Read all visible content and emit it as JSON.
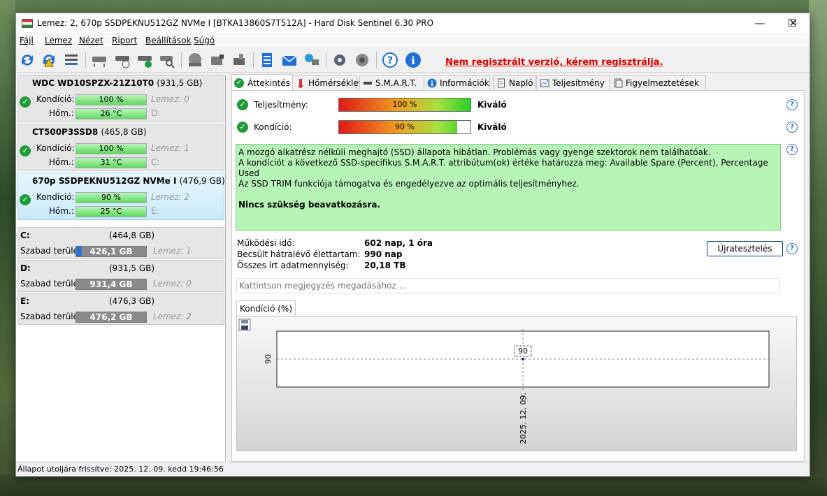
{
  "window": {
    "title": "Lemez: 2, 670p SSDPEKNU512GZ NVMe I [BTKA13860S7T512A]  -  Hard Disk Sentinel 6.30 PRO",
    "controls": {
      "minimize": "—",
      "maximize": "☐",
      "close": "✕"
    }
  },
  "menu": [
    "Fájl",
    "Lemez",
    "Nézet",
    "Riport",
    "Beállítások",
    "Súgó"
  ],
  "toolbar": {
    "unregistered": "Nem regisztrált verzió, kérem regisztrálja."
  },
  "disks": [
    {
      "name": "WDC WD10SPZX-21Z10T0",
      "size": "(931,5 GB)",
      "health_label": "Kondíció:",
      "health": "100 %",
      "health_pct": 100,
      "temp_label": "Hőm.:",
      "temp": "26 °C",
      "disk_label": "Lemez: 0",
      "drive": "D:"
    },
    {
      "name": "CT500P3SSD8",
      "size": "(465,8 GB)",
      "health_label": "Kondíció:",
      "health": "100 %",
      "health_pct": 100,
      "temp_label": "Hőm.:",
      "temp": "31 °C",
      "disk_label": "Lemez: 1",
      "drive": "C:"
    },
    {
      "name": "670p SSDPEKNU512GZ NVMe I",
      "size": "(476,9 GB)",
      "health_label": "Kondíció:",
      "health": "90 %",
      "health_pct": 90,
      "temp_label": "Hőm.:",
      "temp": "25 °C",
      "disk_label": "Lemez: 2",
      "drive": "E:"
    }
  ],
  "volumes": [
    {
      "letter": "C:",
      "size": "(464,8 GB)",
      "free_label": "Szabad terület",
      "free": "426,1 GB",
      "used_fraction": 0.08,
      "disk_label": "Lemez: 1"
    },
    {
      "letter": "D:",
      "size": "(931,5 GB)",
      "free_label": "Szabad terület",
      "free": "931,4 GB",
      "used_fraction": 0.0,
      "disk_label": "Lemez: 0"
    },
    {
      "letter": "E:",
      "size": "(476,3 GB)",
      "free_label": "Szabad terület",
      "free": "476,2 GB",
      "used_fraction": 0.0,
      "disk_label": "Lemez: 2"
    }
  ],
  "tabs": [
    "Áttekintés",
    "Hőmérséklet",
    "S.M.A.R.T.",
    "Információk",
    "Napló",
    "Teljesítmény",
    "Figyelmeztetések"
  ],
  "overview": {
    "performance_label": "Teljesítmény:",
    "performance_value": "100 %",
    "performance_pct": 100,
    "performance_rating": "Kiváló",
    "health_label": "Kondíció:",
    "health_value": "90 %",
    "health_pct": 90,
    "health_rating": "Kiváló",
    "info_lines": [
      "A mozgó alkatrész nélküli meghajtó (SSD) állapota hibátlan. Problémás vagy gyenge szektorok nem találhatóak.",
      "A kondíciót a következő SSD-specifikus S.M.A.R.T. attribútum(ok) értéke határozza meg:  Available Spare (Percent), Percentage Used",
      "Az SSD TRIM funkciója támogatva és engedélyezve az optimális teljesítményhez."
    ],
    "info_action": "Nincs szükség beavatkozásra.",
    "uptime_label": "Működési idő:",
    "uptime": "602 nap, 1 óra",
    "remaining_label": "Becsült hátralévő élettartam:",
    "remaining": "990 nap",
    "written_label": "Összes írt adatmennyiség:",
    "written": "20,18 TB",
    "retest_button": "Újratesztelés",
    "note_placeholder": "Kattintson megjegyzés megadásához ..."
  },
  "chart_data": {
    "type": "line",
    "tab_label": "Kondíció  (%)",
    "x": [
      "2025. 12. 09."
    ],
    "series": [
      {
        "values": [
          90
        ]
      }
    ],
    "data_labels": [
      "90"
    ],
    "y_tick_labels": [
      "90"
    ],
    "grid": true
  },
  "status": {
    "text": "Állapot utoljára frissítve: 2025. 12. 09. kedd 19:46:56"
  }
}
